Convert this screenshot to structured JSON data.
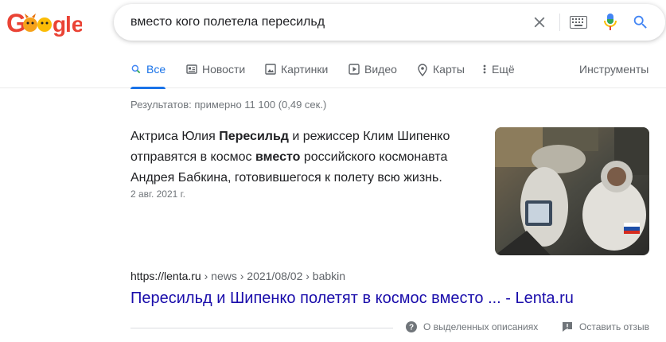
{
  "search": {
    "query": "вместо кого полетела пересильд"
  },
  "tabs": [
    {
      "label": "Все",
      "icon": "search-icon"
    },
    {
      "label": "Новости",
      "icon": "news-icon"
    },
    {
      "label": "Картинки",
      "icon": "image-icon"
    },
    {
      "label": "Видео",
      "icon": "video-icon"
    },
    {
      "label": "Карты",
      "icon": "map-pin-icon"
    },
    {
      "label": "Ещё",
      "icon": "more-vertical-icon"
    }
  ],
  "tools_label": "Инструменты",
  "result_stats": "Результатов: примерно 11 100 (0,49 сек.)",
  "snippet": {
    "segments": [
      {
        "text": "Актриса Юлия ",
        "bold": false
      },
      {
        "text": "Пересильд",
        "bold": true
      },
      {
        "text": " и режиссер Клим Шипенко отправятся в космос ",
        "bold": false
      },
      {
        "text": "вместо",
        "bold": true
      },
      {
        "text": " российского космонавта Андрея Бабкина, готовившегося к полету всю жизнь.",
        "bold": false
      }
    ],
    "date": "2 авг. 2021 г."
  },
  "result": {
    "cite_domain": "https://lenta.ru",
    "cite_path": " › news › 2021/08/02 › babkin",
    "title": "Пересильд и Шипенко полетят в космос вместо ... - Lenta.ru"
  },
  "footer": {
    "about": "О выделенных описаниях",
    "feedback": "Оставить отзыв"
  },
  "colors": {
    "accent": "#1a73e8",
    "link": "#1a0dab",
    "muted": "#70757a"
  }
}
